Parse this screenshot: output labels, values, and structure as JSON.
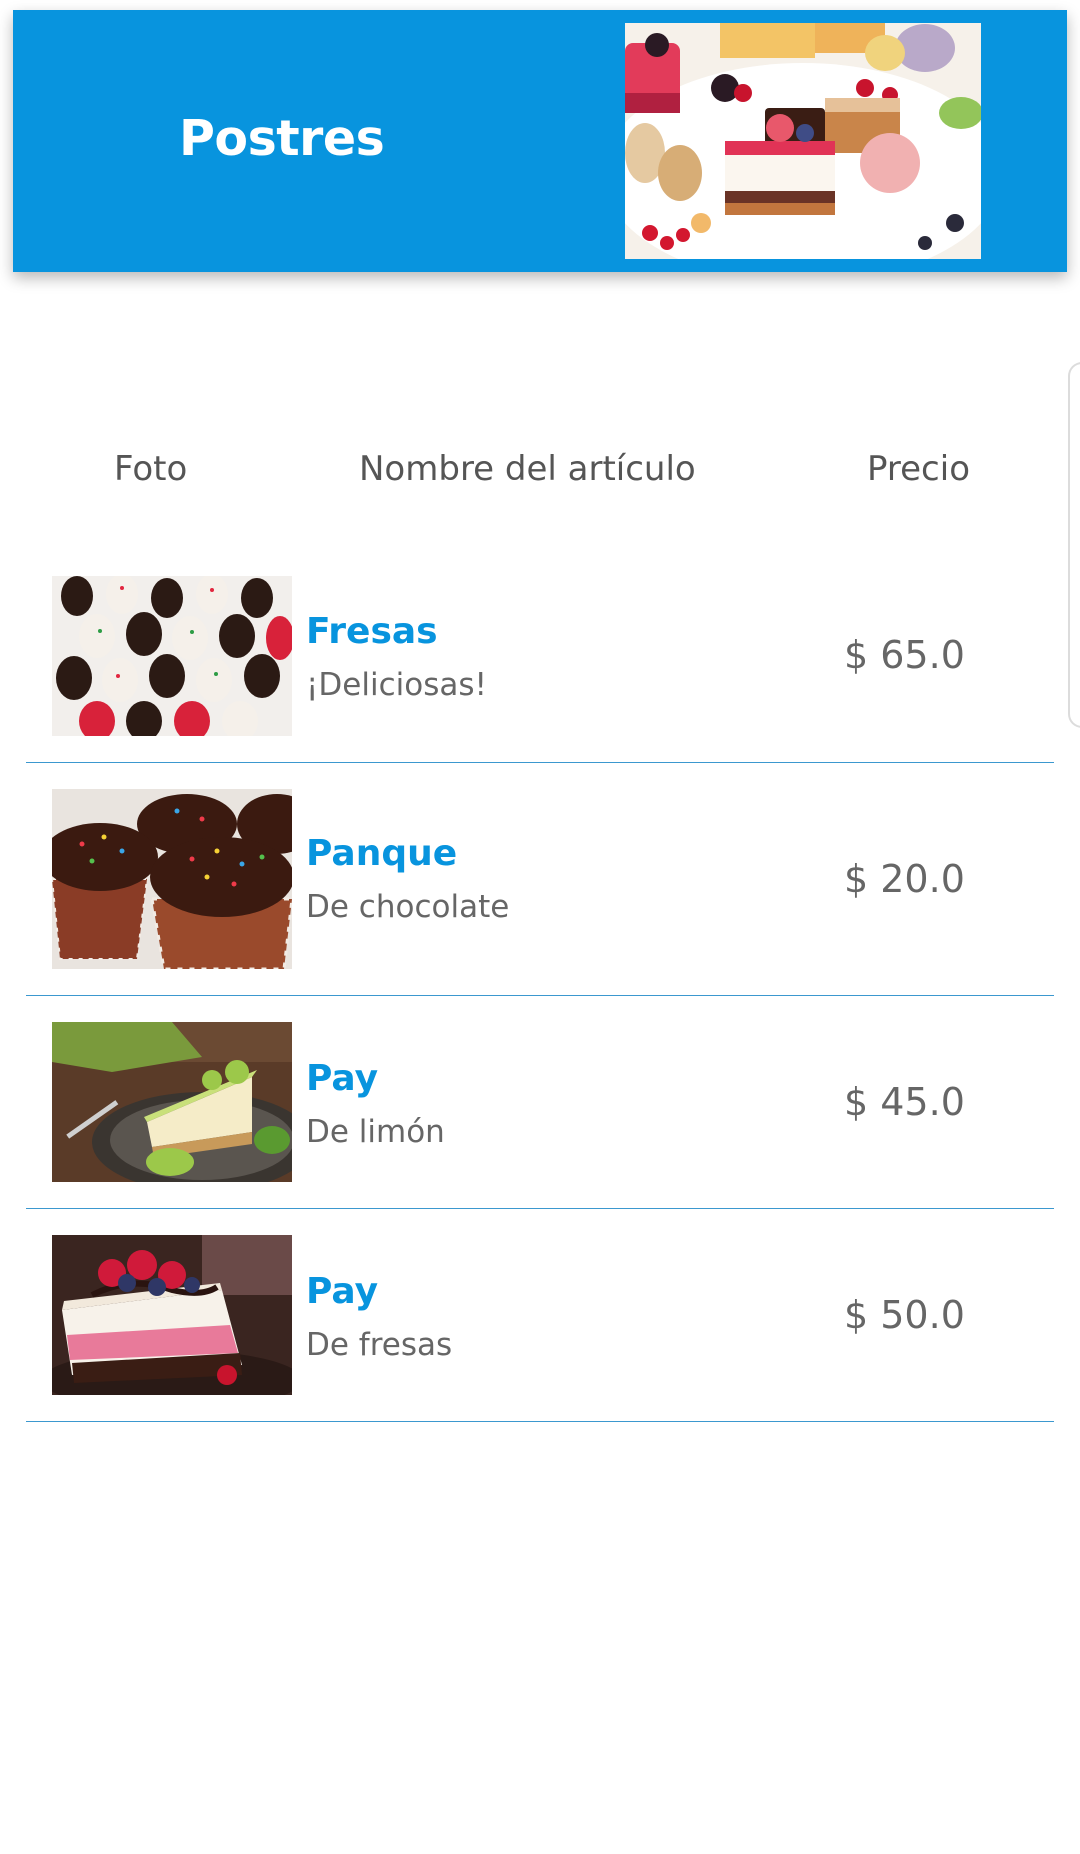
{
  "header": {
    "title": "Postres",
    "image": "assorted-desserts-plate"
  },
  "table": {
    "columns": [
      "Foto",
      "Nombre del artículo",
      "Precio"
    ],
    "rows": [
      {
        "image": "chocolate-covered-strawberries",
        "name": "Fresas",
        "description": "¡Deliciosas!",
        "price": "$ 65.0"
      },
      {
        "image": "chocolate-sprinkle-cupcakes",
        "name": "Panque",
        "description": "De chocolate",
        "price": "$ 20.0"
      },
      {
        "image": "key-lime-pie-slice",
        "name": "Pay",
        "description": "De limón",
        "price": "$ 45.0"
      },
      {
        "image": "strawberry-cheesecake-slice",
        "name": "Pay",
        "description": "De fresas",
        "price": "$ 50.0"
      }
    ]
  },
  "colors": {
    "primary": "#0894de",
    "text_muted": "#666666",
    "divider": "#3b98cf"
  }
}
